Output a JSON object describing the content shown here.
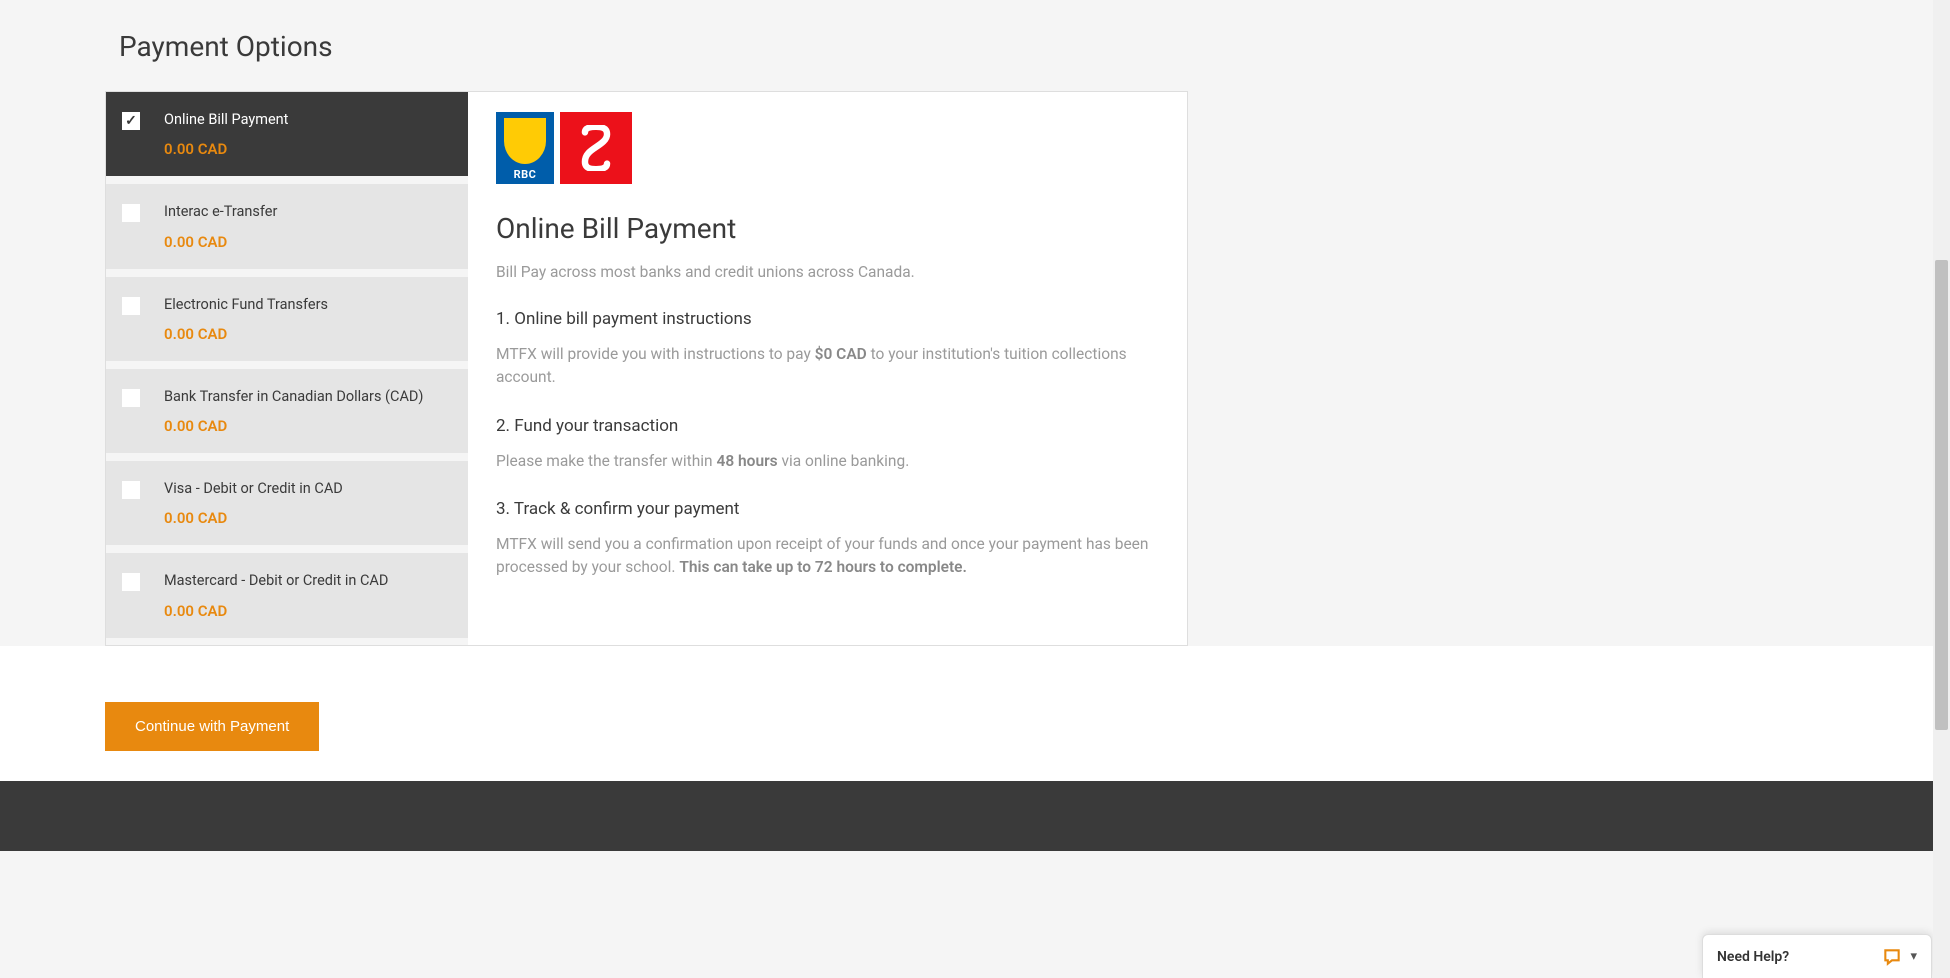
{
  "page": {
    "title": "Payment Options"
  },
  "options": [
    {
      "label": "Online Bill Payment",
      "price": "0.00 CAD",
      "selected": true
    },
    {
      "label": "Interac e-Transfer",
      "price": "0.00 CAD",
      "selected": false
    },
    {
      "label": "Electronic Fund Transfers",
      "price": "0.00 CAD",
      "selected": false
    },
    {
      "label": "Bank Transfer in Canadian Dollars (CAD)",
      "price": "0.00 CAD",
      "selected": false
    },
    {
      "label": "Visa - Debit or Credit in CAD",
      "price": "0.00 CAD",
      "selected": false
    },
    {
      "label": "Mastercard - Debit or Credit in CAD",
      "price": "0.00 CAD",
      "selected": false
    }
  ],
  "detail": {
    "title": "Online Bill Payment",
    "subtitle": "Bill Pay across most banks and credit unions across Canada.",
    "step1_title": "1. Online bill payment instructions",
    "step1_desc_a": "MTFX will provide you with instructions to pay ",
    "step1_desc_bold": "$0 CAD",
    "step1_desc_b": " to your institution's tuition collections account.",
    "step2_title": "2. Fund your transaction",
    "step2_desc_a": "Please make the transfer within ",
    "step2_desc_bold": "48 hours",
    "step2_desc_b": " via online banking.",
    "step3_title": "3. Track & confirm your payment",
    "step3_desc_a": "MTFX will send you a confirmation upon receipt of your funds and once your payment has been processed by your school. ",
    "step3_desc_bold": "This can take up to 72 hours to complete.",
    "step3_desc_b": ""
  },
  "bank_logos": {
    "rbc_label": "RBC"
  },
  "actions": {
    "continue_label": "Continue with Payment"
  },
  "help": {
    "label": "Need Help?"
  }
}
